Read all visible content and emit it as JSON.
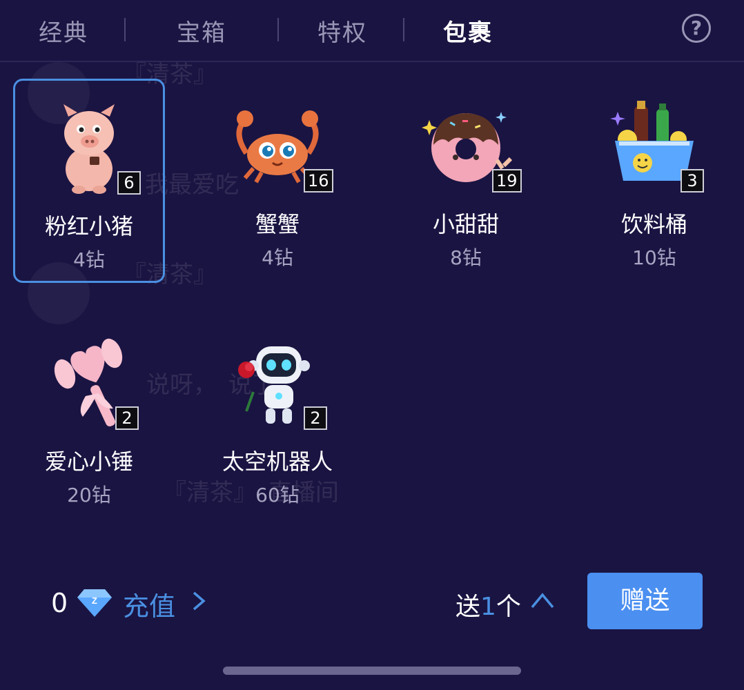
{
  "tabs": [
    {
      "label": "经典",
      "active": false
    },
    {
      "label": "宝箱",
      "active": false
    },
    {
      "label": "特权",
      "active": false
    },
    {
      "label": "包裹",
      "active": true
    }
  ],
  "help_icon": "question-circle-icon",
  "gifts": [
    {
      "name": "粉红小猪",
      "price": "4钻",
      "qty": "6",
      "icon": "pig-icon",
      "selected": true
    },
    {
      "name": "蟹蟹",
      "price": "4钻",
      "qty": "16",
      "icon": "crab-icon",
      "selected": false
    },
    {
      "name": "小甜甜",
      "price": "8钻",
      "qty": "19",
      "icon": "donut-icon",
      "selected": false
    },
    {
      "name": "饮料桶",
      "price": "10钻",
      "qty": "3",
      "icon": "drink-bucket-icon",
      "selected": false
    },
    {
      "name": "爱心小锤",
      "price": "20钻",
      "qty": "2",
      "icon": "heart-hammer-icon",
      "selected": false
    },
    {
      "name": "太空机器人",
      "price": "60钻",
      "qty": "2",
      "icon": "robot-icon",
      "selected": false
    }
  ],
  "footer": {
    "balance": "0",
    "recharge_label": "充值",
    "send_prefix": "送",
    "send_count": "1",
    "send_suffix": "个",
    "send_button": "赠送"
  },
  "colors": {
    "background": "#1a1442",
    "accent": "#4a90e2",
    "button": "#4b8ff0"
  }
}
